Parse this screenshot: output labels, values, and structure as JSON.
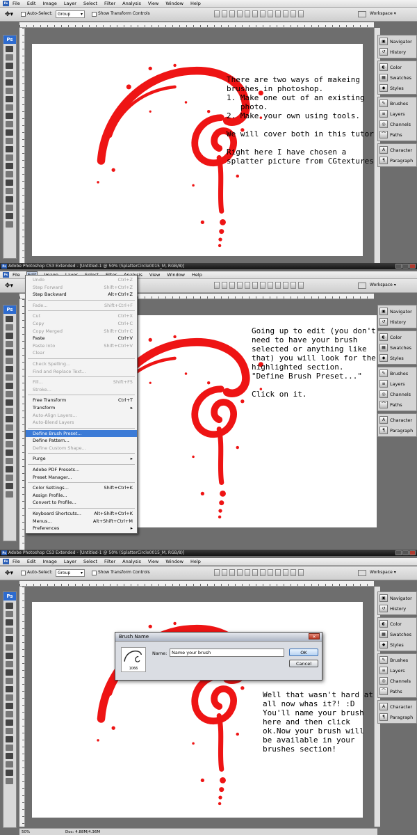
{
  "app": {
    "title": "Adobe Photoshop CS3 Extended - [Untitled-1 @ 50% (SplatterCircle0015_M, RGB/8)]",
    "logo": "Ps"
  },
  "menu": [
    "File",
    "Edit",
    "Image",
    "Layer",
    "Select",
    "Filter",
    "Analysis",
    "View",
    "Window",
    "Help"
  ],
  "options": {
    "auto_select_label": "Auto-Select:",
    "auto_select_value": "Group",
    "transform_label": "Show Transform Controls",
    "workspace_label": "Workspace ▾"
  },
  "panels": {
    "group1": [
      "Navigator",
      "History"
    ],
    "group2": [
      "Color",
      "Swatches",
      "Styles"
    ],
    "group3": [
      "Brushes",
      "Layers",
      "Channels",
      "Paths"
    ],
    "group4": [
      "Character",
      "Paragraph"
    ]
  },
  "step1": {
    "caption": "There are two ways of makeing\nbrushes in photoshop.\n1. Make one out of an existing\n   photo.\n2. Make your own using tools.\n\nWe will cover both in this tutorial.\n\nRight here I have chosen a\nsplatter picture from CGtextures."
  },
  "step2": {
    "caption": "Going up to edit (you don't\nneed to have your brush\nselected or anything like\nthat) you will look for the\nhighlighted section.\n\"Define Brush Preset...\"\n\nClick on it.",
    "edit_menu": [
      {
        "label": "Undo",
        "shortcut": "Ctrl+Z",
        "disabled": true
      },
      {
        "label": "Step Forward",
        "shortcut": "Shift+Ctrl+Z",
        "disabled": true
      },
      {
        "label": "Step Backward",
        "shortcut": "Alt+Ctrl+Z",
        "disabled": false
      },
      {
        "sep": true
      },
      {
        "label": "Fade...",
        "shortcut": "Shift+Ctrl+F",
        "disabled": true
      },
      {
        "sep": true
      },
      {
        "label": "Cut",
        "shortcut": "Ctrl+X",
        "disabled": true
      },
      {
        "label": "Copy",
        "shortcut": "Ctrl+C",
        "disabled": true
      },
      {
        "label": "Copy Merged",
        "shortcut": "Shift+Ctrl+C",
        "disabled": true
      },
      {
        "label": "Paste",
        "shortcut": "Ctrl+V",
        "disabled": false
      },
      {
        "label": "Paste Into",
        "shortcut": "Shift+Ctrl+V",
        "disabled": true
      },
      {
        "label": "Clear",
        "shortcut": "",
        "disabled": true
      },
      {
        "sep": true
      },
      {
        "label": "Check Spelling...",
        "shortcut": "",
        "disabled": true
      },
      {
        "label": "Find and Replace Text...",
        "shortcut": "",
        "disabled": true
      },
      {
        "sep": true
      },
      {
        "label": "Fill...",
        "shortcut": "Shift+F5",
        "disabled": true
      },
      {
        "label": "Stroke...",
        "shortcut": "",
        "disabled": true
      },
      {
        "sep": true
      },
      {
        "label": "Free Transform",
        "shortcut": "Ctrl+T",
        "disabled": false
      },
      {
        "label": "Transform",
        "shortcut": "▸",
        "disabled": false
      },
      {
        "label": "Auto-Align Layers...",
        "shortcut": "",
        "disabled": true
      },
      {
        "label": "Auto-Blend Layers",
        "shortcut": "",
        "disabled": true
      },
      {
        "sep": true
      },
      {
        "label": "Define Brush Preset...",
        "shortcut": "",
        "disabled": false,
        "highlight": true
      },
      {
        "label": "Define Pattern...",
        "shortcut": "",
        "disabled": false
      },
      {
        "label": "Define Custom Shape...",
        "shortcut": "",
        "disabled": true
      },
      {
        "sep": true
      },
      {
        "label": "Purge",
        "shortcut": "▸",
        "disabled": false
      },
      {
        "sep": true
      },
      {
        "label": "Adobe PDF Presets...",
        "shortcut": "",
        "disabled": false
      },
      {
        "label": "Preset Manager...",
        "shortcut": "",
        "disabled": false
      },
      {
        "sep": true
      },
      {
        "label": "Color Settings...",
        "shortcut": "Shift+Ctrl+K",
        "disabled": false
      },
      {
        "label": "Assign Profile...",
        "shortcut": "",
        "disabled": false
      },
      {
        "label": "Convert to Profile...",
        "shortcut": "",
        "disabled": false
      },
      {
        "sep": true
      },
      {
        "label": "Keyboard Shortcuts...",
        "shortcut": "Alt+Shift+Ctrl+K",
        "disabled": false
      },
      {
        "label": "Menus...",
        "shortcut": "Alt+Shift+Ctrl+M",
        "disabled": false
      },
      {
        "label": "Preferences",
        "shortcut": "▸",
        "disabled": false
      }
    ]
  },
  "step3": {
    "caption": "Well that wasn't hard at\nall now whas it?! :D\nYou'll name your brush\nhere and then click\nok.Now your brush will\nbe available in your\nbrushes section!",
    "dialog": {
      "title": "Brush Name",
      "name_label": "Name:",
      "name_value": "Name your brush",
      "ok": "OK",
      "cancel": "Cancel",
      "brush_size": "1066"
    },
    "status": {
      "zoom": "50%",
      "doc": "Doc: 4.88M/4.36M"
    }
  }
}
